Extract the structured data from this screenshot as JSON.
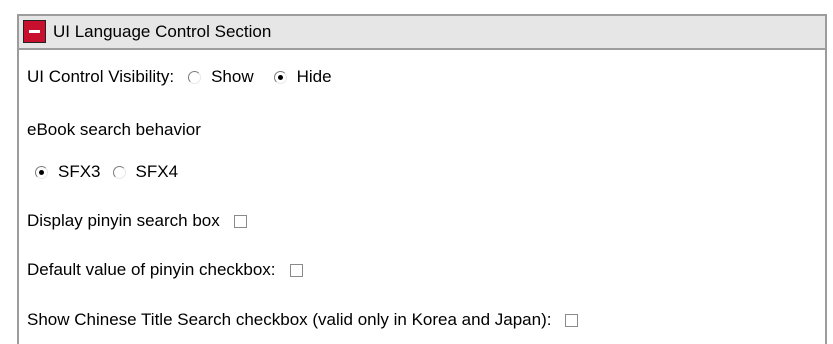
{
  "section": {
    "title": "UI Language Control Section"
  },
  "ui_control_visibility": {
    "label": "UI Control Visibility:",
    "options": [
      {
        "label": "Show",
        "checked": false
      },
      {
        "label": "Hide",
        "checked": true
      }
    ]
  },
  "ebook_search": {
    "label": "eBook search behavior",
    "options": [
      {
        "label": "SFX3",
        "checked": true
      },
      {
        "label": "SFX4",
        "checked": false
      }
    ]
  },
  "pinyin_search_box": {
    "label": "Display pinyin search box",
    "checked": false
  },
  "pinyin_default": {
    "label": "Default value of pinyin checkbox:",
    "checked": false
  },
  "chinese_title_search": {
    "label": "Show Chinese Title Search checkbox (valid only in Korea and Japan):",
    "checked": false
  }
}
